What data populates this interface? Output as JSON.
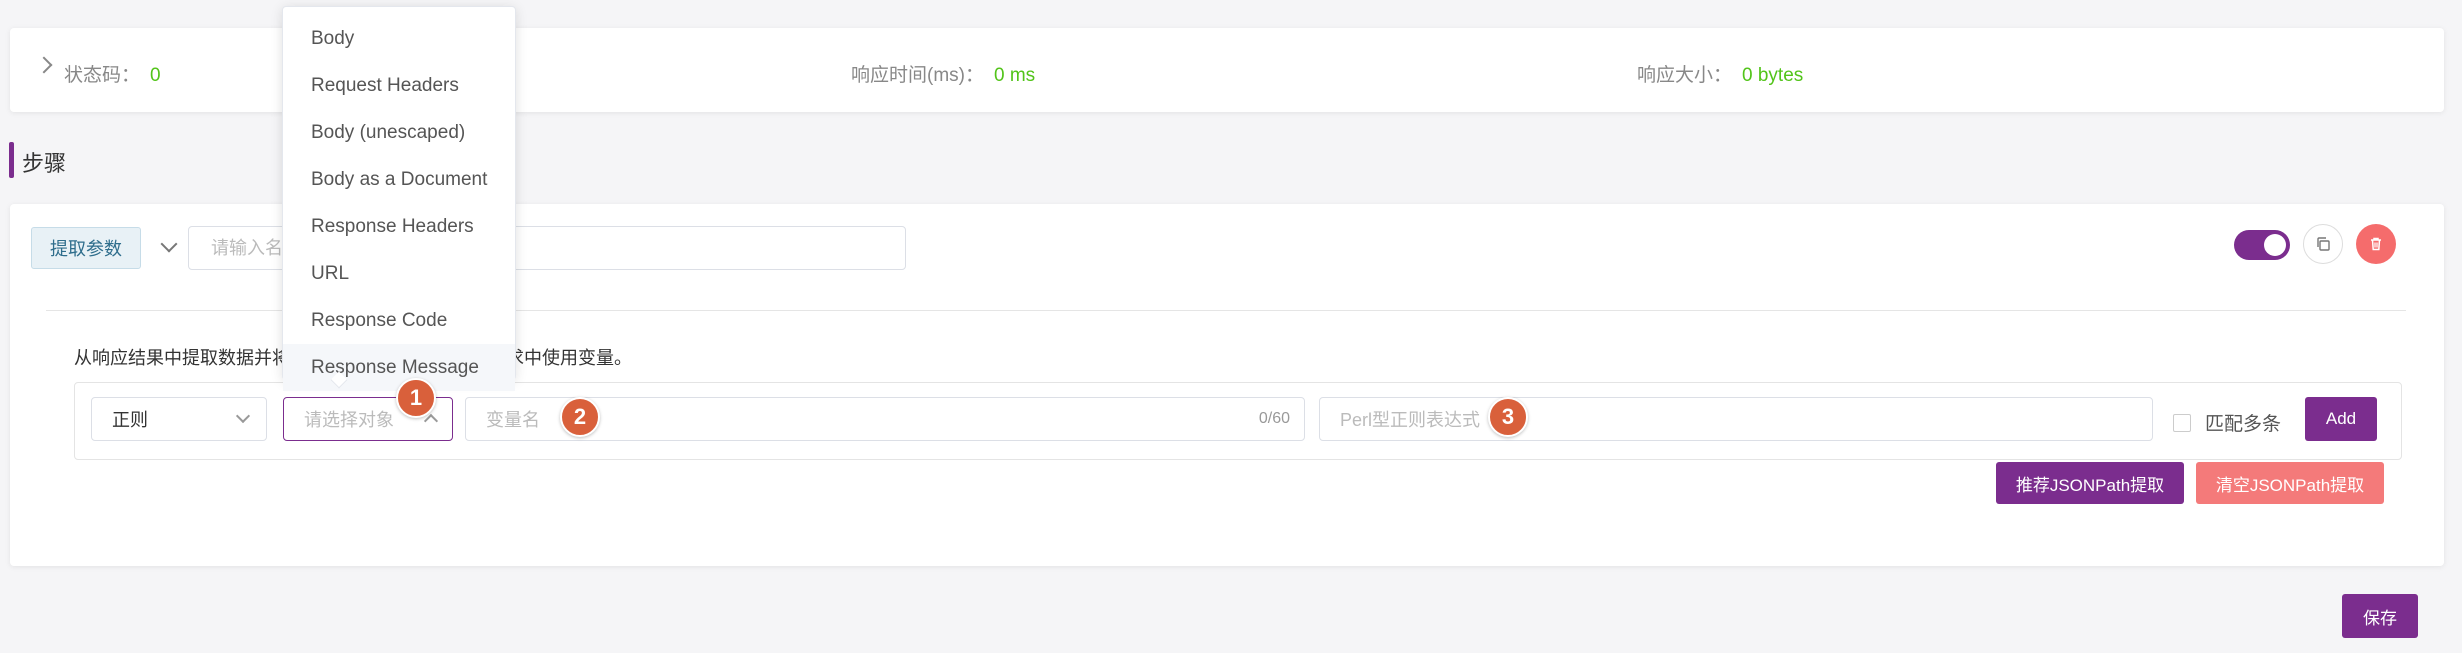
{
  "response_stats": {
    "status_label": "状态码：",
    "status_value": "0",
    "time_label": "响应时间(ms)：",
    "time_value": "0 ms",
    "size_label": "响应大小：",
    "size_value": "0 bytes"
  },
  "steps": {
    "title": "步骤",
    "step": {
      "type_tag": "提取参数",
      "name_placeholder": "请输入名称",
      "enabled": true,
      "description": "从响应结果中提取数据并将其存储在变量中，在后续请求中使用变量。",
      "extract": {
        "type_value": "正则",
        "target_placeholder": "请选择对象",
        "var_placeholder": "变量名",
        "var_count": "0/60",
        "regex_placeholder": "Perl型正则表达式",
        "match_multiple_label": "匹配多条",
        "add_label": "Add"
      },
      "recommend_label": "推荐JSONPath提取",
      "clear_label": "清空JSONPath提取"
    }
  },
  "save_label": "保存",
  "dropdown": {
    "options": [
      "Body",
      "Request Headers",
      "Body (unescaped)",
      "Body as a Document",
      "Response Headers",
      "URL",
      "Response Code",
      "Response Message"
    ]
  },
  "markers": [
    "1",
    "2",
    "3"
  ],
  "colors": {
    "primary": "#7b2d8e",
    "success": "#52c41a",
    "danger": "#f56c6c",
    "marker": "#d9603b"
  }
}
